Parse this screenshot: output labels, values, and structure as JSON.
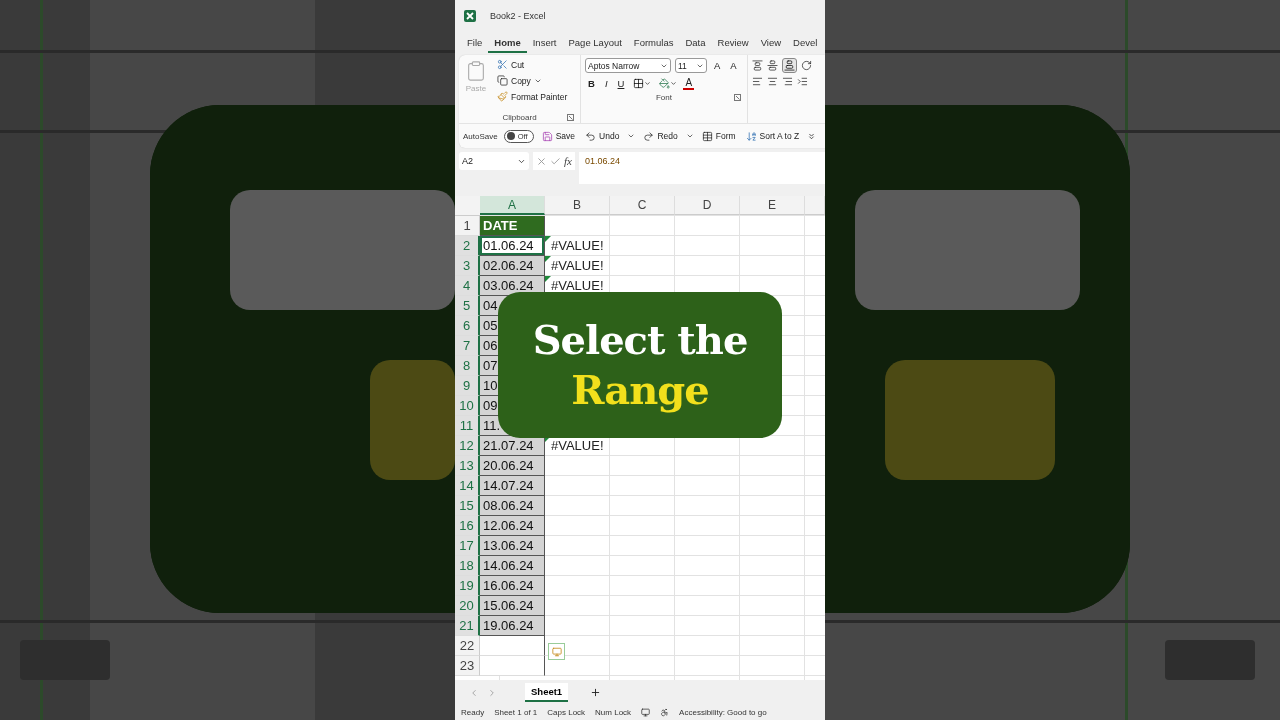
{
  "window": {
    "title": "Book2 - Excel"
  },
  "ribbon_tabs": [
    {
      "label": "File",
      "selected": false
    },
    {
      "label": "Home",
      "selected": true
    },
    {
      "label": "Insert",
      "selected": false
    },
    {
      "label": "Page Layout",
      "selected": false
    },
    {
      "label": "Formulas",
      "selected": false
    },
    {
      "label": "Data",
      "selected": false
    },
    {
      "label": "Review",
      "selected": false
    },
    {
      "label": "View",
      "selected": false
    },
    {
      "label": "Devel",
      "selected": false
    }
  ],
  "clipboard": {
    "paste": {
      "label": "Paste",
      "disabled": true
    },
    "cut": "Cut",
    "copy": "Copy",
    "format_painter": "Format Painter",
    "group_label": "Clipboard"
  },
  "font": {
    "name": "Aptos Narrow",
    "size": "11",
    "grow": "A",
    "shrink": "A",
    "bold": "B",
    "italic": "I",
    "underline": "U",
    "font_color": "A",
    "group_label": "Font"
  },
  "quick_access": {
    "autosave": {
      "label": "AutoSave",
      "state": "Off",
      "on": false
    },
    "save": "Save",
    "undo": "Undo",
    "redo": "Redo",
    "form": "Form",
    "sort": "Sort A to Z"
  },
  "formula_bar": {
    "name_box": "A2",
    "fx_label": "fx",
    "value": "01.06.24"
  },
  "columns": [
    "A",
    "B",
    "C",
    "D",
    "E"
  ],
  "rows": [
    {
      "number": "1",
      "a": "DATE",
      "kind": "header",
      "selected": false,
      "active": false
    },
    {
      "number": "2",
      "a": "01.06.24",
      "b": "#VALUE!",
      "kind": "data",
      "selected": true,
      "active": true
    },
    {
      "number": "3",
      "a": "02.06.24",
      "b": "#VALUE!",
      "kind": "data",
      "selected": true,
      "active": false
    },
    {
      "number": "4",
      "a": "03.06.24",
      "b": "#VALUE!",
      "kind": "data",
      "selected": true,
      "active": false
    },
    {
      "number": "5",
      "a": "04",
      "kind": "data",
      "selected": true,
      "active": false
    },
    {
      "number": "6",
      "a": "05",
      "kind": "data",
      "selected": true,
      "active": false
    },
    {
      "number": "7",
      "a": "06",
      "kind": "data",
      "selected": true,
      "active": false
    },
    {
      "number": "8",
      "a": "07",
      "kind": "data",
      "selected": true,
      "active": false
    },
    {
      "number": "9",
      "a": "10",
      "kind": "data",
      "selected": true,
      "active": false
    },
    {
      "number": "10",
      "a": "09",
      "kind": "data",
      "selected": true,
      "active": false
    },
    {
      "number": "11",
      "a": "11.",
      "kind": "data",
      "selected": true,
      "active": false
    },
    {
      "number": "12",
      "a": "21.07.24",
      "b": "#VALUE!",
      "kind": "data",
      "selected": true,
      "active": false
    },
    {
      "number": "13",
      "a": "20.06.24",
      "kind": "data",
      "selected": true,
      "active": false
    },
    {
      "number": "14",
      "a": "14.07.24",
      "kind": "data",
      "selected": true,
      "active": false
    },
    {
      "number": "15",
      "a": "08.06.24",
      "kind": "data",
      "selected": true,
      "active": false
    },
    {
      "number": "16",
      "a": "12.06.24",
      "kind": "data",
      "selected": true,
      "active": false
    },
    {
      "number": "17",
      "a": "13.06.24",
      "kind": "data",
      "selected": true,
      "active": false
    },
    {
      "number": "18",
      "a": "14.06.24",
      "kind": "data",
      "selected": true,
      "active": false
    },
    {
      "number": "19",
      "a": "16.06.24",
      "kind": "data",
      "selected": true,
      "active": false
    },
    {
      "number": "20",
      "a": "15.06.24",
      "kind": "data",
      "selected": true,
      "active": false
    },
    {
      "number": "21",
      "a": "19.06.24",
      "kind": "data",
      "selected": true,
      "active": false
    },
    {
      "number": "22",
      "kind": "data",
      "selected": false,
      "active": false
    },
    {
      "number": "23",
      "kind": "data",
      "selected": false,
      "active": false
    }
  ],
  "overlay": {
    "line1": "Select the",
    "line2": "Range"
  },
  "sheet_tabs": [
    {
      "label": "Sheet1",
      "selected": true
    }
  ],
  "status_bar": {
    "items": [
      "Ready",
      "Sheet 1 of 1",
      "Caps Lock",
      "Num Lock"
    ],
    "accessibility": "Accessibility: Good to go"
  }
}
